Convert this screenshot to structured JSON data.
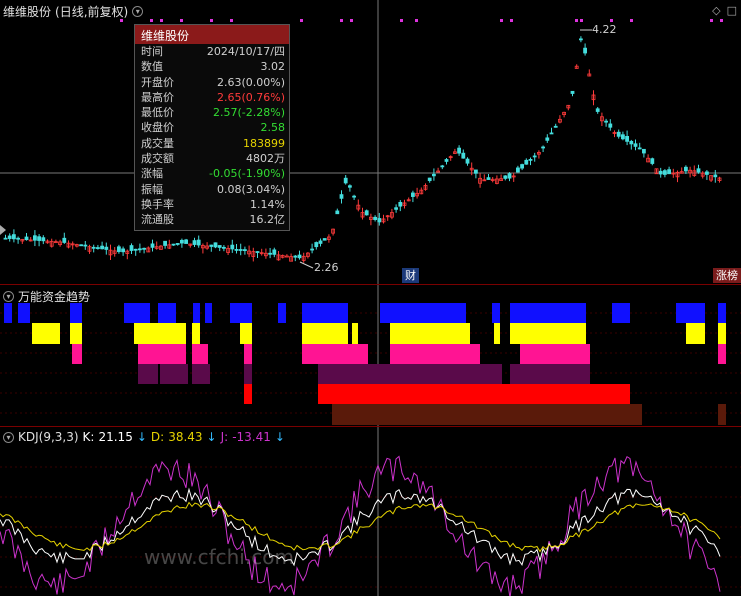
{
  "main": {
    "title": "维维股份",
    "subtitle": "(日线,前复权)",
    "high_label": "4.22",
    "low_label": "2.26",
    "badge_cai": "财",
    "badge_zb": "涨榜"
  },
  "tooltip": {
    "title": "维维股份",
    "rows": [
      {
        "label": "时间",
        "value": "2024/10/17/四",
        "color": "normal"
      },
      {
        "label": "数值",
        "value": "3.02",
        "color": "normal"
      },
      {
        "label": "开盘价",
        "value": "2.63(0.00%)",
        "color": "normal"
      },
      {
        "label": "最高价",
        "value": "2.65(0.76%)",
        "color": "red"
      },
      {
        "label": "最低价",
        "value": "2.57(-2.28%)",
        "color": "green"
      },
      {
        "label": "收盘价",
        "value": "2.58",
        "color": "green"
      },
      {
        "label": "成交量",
        "value": "183899",
        "color": "yellow"
      },
      {
        "label": "成交额",
        "value": "4802万",
        "color": "normal"
      },
      {
        "label": "涨幅",
        "value": "-0.05(-1.90%)",
        "color": "green"
      },
      {
        "label": "振幅",
        "value": "0.08(3.04%)",
        "color": "normal"
      },
      {
        "label": "换手率",
        "value": "1.14%",
        "color": "normal"
      },
      {
        "label": "流通股",
        "value": "16.2亿",
        "color": "normal"
      }
    ]
  },
  "fund": {
    "title": "万能资金趋势"
  },
  "kdj": {
    "title": "KDJ(9,3,3)",
    "k_label": "K:",
    "k_value": "21.15",
    "d_label": "D:",
    "d_value": "38.43",
    "j_label": "J:",
    "j_value": "-13.41",
    "arrow": "↓"
  },
  "watermark": "www.cfchi.com",
  "colors": {
    "up": "#ff3b3b",
    "down": "#44dddd",
    "k_line": "#ffffff",
    "d_line": "#e6d300",
    "j_line": "#cc33cc"
  }
}
